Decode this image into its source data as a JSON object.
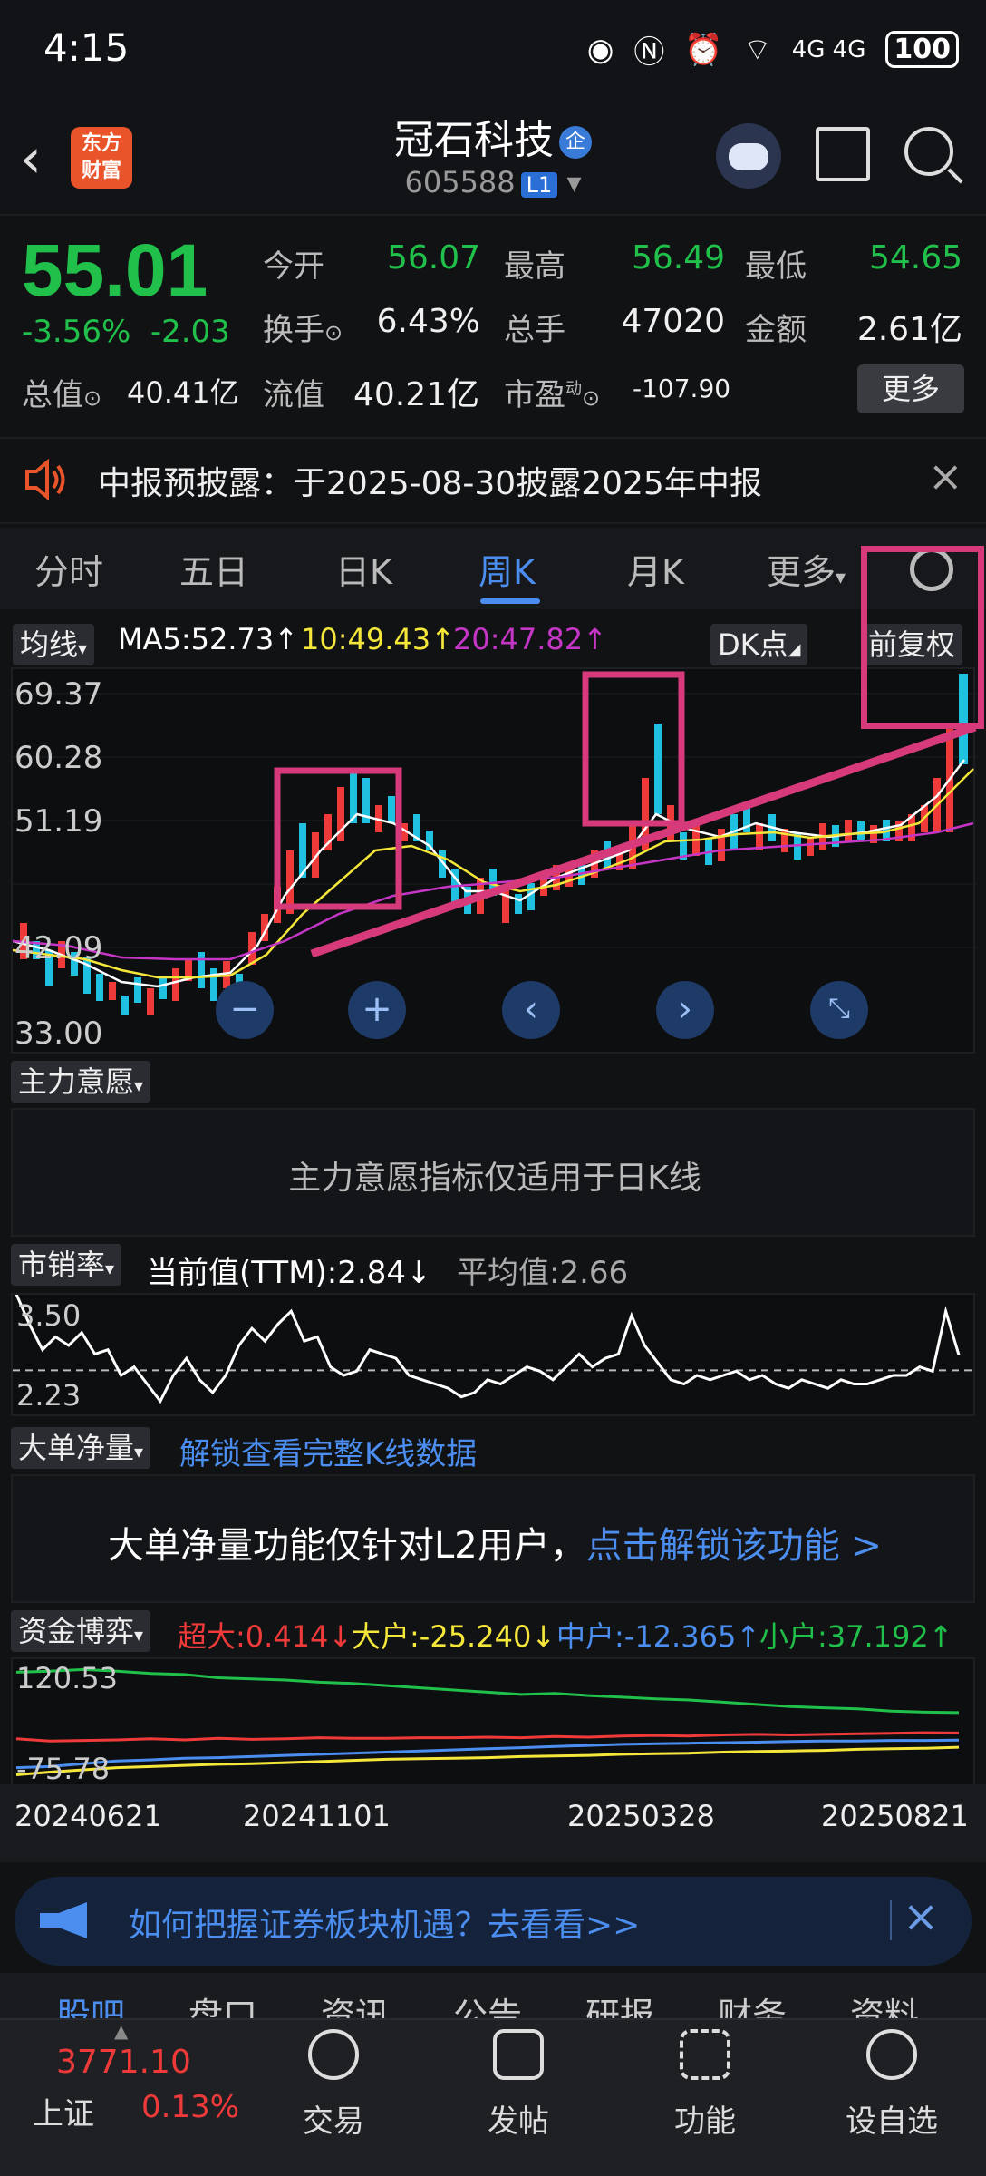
{
  "status_bar": {
    "time": "4:15",
    "battery": "100",
    "network": "4G 4G",
    "icons": [
      "eye-icon",
      "nfc-icon",
      "alarm-icon",
      "wifi-icon",
      "signal-icon",
      "battery-icon"
    ]
  },
  "header": {
    "logo_line1": "东方",
    "logo_line2": "财富",
    "stock_name": "冠石科技",
    "badge": "企",
    "stock_code": "605588",
    "level_badge": "L1"
  },
  "quote": {
    "price": "55.01",
    "change_pct": "-3.56%",
    "change_abs": "-2.03",
    "open_label": "今开",
    "open": "56.07",
    "high_label": "最高",
    "high": "56.49",
    "low_label": "最低",
    "low": "54.65",
    "turnover_label": "换手",
    "turnover": "6.43%",
    "volume_label": "总手",
    "volume": "47020",
    "amount_label": "金额",
    "amount": "2.61亿",
    "mcap_label": "总值",
    "mcap": "40.41亿",
    "float_label": "流值",
    "float": "40.21亿",
    "pe_label": "市盈",
    "pe_sup": "动",
    "pe": "-107.90",
    "more": "更多"
  },
  "announcement": {
    "text": "中报预披露：于2025-08-30披露2025年中报"
  },
  "tabs": [
    "分时",
    "五日",
    "日K",
    "周K",
    "月K",
    "更多"
  ],
  "ma_row": {
    "selector": "均线",
    "ma5": "MA5:52.73↑",
    "ma10": "10:49.43↑",
    "ma20": "20:47.82↑",
    "dk": "DK点",
    "fq": "前复权"
  },
  "kline_axis": [
    "69.37",
    "60.28",
    "51.19",
    "42.09",
    "33.00"
  ],
  "indicator_main": {
    "selector": "主力意愿",
    "message": "主力意愿指标仅适用于日K线"
  },
  "ps_panel": {
    "selector": "市销率",
    "current": "当前值(TTM):2.84↓",
    "avg": "平均值:2.66",
    "axis_top": "3.50",
    "axis_bottom": "2.23"
  },
  "big_order": {
    "selector": "大单净量",
    "link": "解锁查看完整K线数据",
    "message": "大单净量功能仅针对L2用户，",
    "unlock": "点击解锁该功能 >"
  },
  "fund_game": {
    "selector": "资金博弈",
    "super": "超大:0.414↓",
    "large": "大户:-25.240↓",
    "mid": "中户:-12.365↑",
    "small": "小户:37.192↑",
    "axis_top": "120.53",
    "axis_bottom": "-75.78"
  },
  "dates": [
    "20240621",
    "20241101",
    "20250328",
    "20250821"
  ],
  "promo": {
    "text": "如何把握证券板块机遇？去看看>>"
  },
  "sub_tabs": [
    "股吧",
    "盘口",
    "资讯",
    "公告",
    "研报",
    "财务",
    "资料"
  ],
  "bottom": {
    "index_value": "3771.10",
    "index_name": "上证",
    "index_pct": "0.13%",
    "trade": "交易",
    "post": "发帖",
    "func": "功能",
    "watch": "设自选"
  },
  "colors": {
    "up": "#ef3a3a",
    "down": "#20c04a",
    "accent": "#4b8ef0",
    "highlight": "#d63a7a",
    "ma5": "#ffffff",
    "ma10": "#f5e63a",
    "ma20": "#c636c6"
  },
  "chart_data": [
    {
      "type": "line",
      "title": "市销率",
      "ylim": [
        2.23,
        3.5
      ],
      "series": [
        {
          "name": "市销率",
          "values": [
            3.55,
            3.2,
            2.9,
            3.05,
            2.95,
            3.1,
            2.85,
            2.9,
            2.6,
            2.7,
            2.5,
            2.3,
            2.6,
            2.8,
            2.55,
            2.4,
            2.6,
            2.95,
            3.15,
            3.0,
            3.2,
            3.35,
            3.0,
            3.05,
            2.7,
            2.6,
            2.65,
            2.9,
            2.85,
            2.8,
            2.6,
            2.55,
            2.5,
            2.45,
            2.35,
            2.4,
            2.55,
            2.5,
            2.6,
            2.7,
            2.65,
            2.55,
            2.7,
            2.85,
            2.7,
            2.8,
            2.85,
            3.3,
            2.95,
            2.75,
            2.55,
            2.5,
            2.6,
            2.55,
            2.6,
            2.65,
            2.55,
            2.6,
            2.5,
            2.45,
            2.55,
            2.5,
            2.45,
            2.55,
            2.5,
            2.5,
            2.55,
            2.6,
            2.6,
            2.7,
            2.65,
            3.35,
            2.84
          ]
        }
      ]
    },
    {
      "type": "line",
      "title": "资金博弈",
      "ylim": [
        -75.78,
        120.53
      ],
      "series": [
        {
          "name": "超大",
          "values": [
            -10,
            -14,
            -13,
            -12,
            -10,
            -12,
            -9,
            -11,
            -10,
            -8,
            -9,
            -9,
            -8,
            -8,
            -7,
            -8,
            -6,
            -7,
            -5,
            -4,
            -5,
            -3,
            -2,
            -3,
            -2,
            -1,
            0,
            1,
            0.414
          ]
        },
        {
          "name": "大户",
          "values": [
            -75,
            -70,
            -66,
            -62,
            -60,
            -58,
            -56,
            -55,
            -53,
            -51,
            -49,
            -47,
            -46,
            -45,
            -44,
            -42,
            -41,
            -40,
            -38,
            -37,
            -36,
            -34,
            -33,
            -32,
            -31,
            -29,
            -28,
            -27,
            -25.24
          ]
        },
        {
          "name": "中户",
          "values": [
            -62,
            -60,
            -55,
            -50,
            -48,
            -45,
            -44,
            -42,
            -40,
            -38,
            -36,
            -34,
            -32,
            -30,
            -28,
            -26,
            -24,
            -22,
            -20,
            -19,
            -18,
            -17,
            -16,
            -15,
            -14,
            -14,
            -13,
            -13,
            -12.365
          ]
        },
        {
          "name": "小户",
          "values": [
            110,
            112,
            115,
            112,
            108,
            106,
            100,
            98,
            96,
            92,
            90,
            86,
            82,
            78,
            74,
            70,
            72,
            68,
            65,
            62,
            60,
            56,
            52,
            48,
            46,
            44,
            40,
            38,
            37.192
          ]
        }
      ]
    }
  ]
}
